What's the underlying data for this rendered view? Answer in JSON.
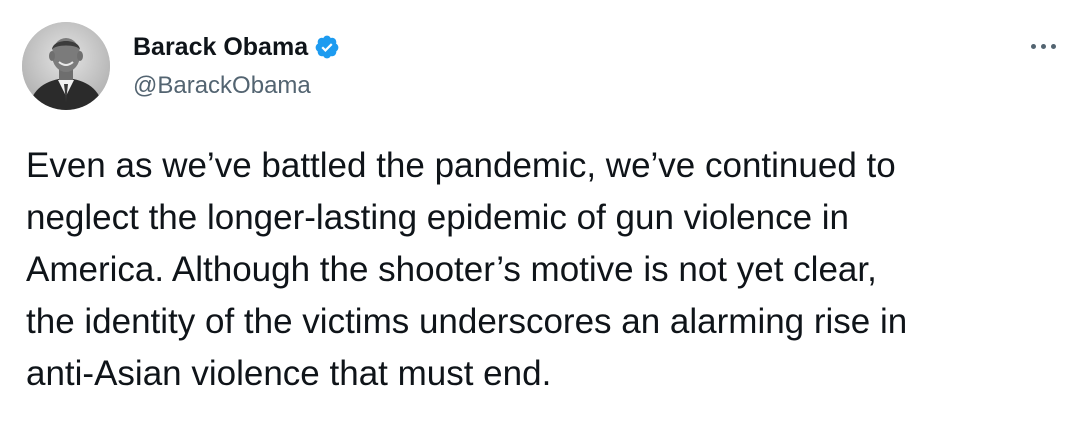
{
  "author": {
    "display_name": "Barack Obama",
    "handle": "@BarackObama",
    "verified": true,
    "avatar_icon": "profile-photo-avatar"
  },
  "tweet": {
    "text": "Even as we’ve battled the pandemic, we’ve continued to\nneglect the longer-lasting epidemic of gun violence in\nAmerica. Although the shooter’s motive is not yet clear,\nthe identity of the victims underscores an alarming rise in\nanti-Asian violence that must end."
  },
  "icons": {
    "verified": "verified-badge-icon",
    "more": "more-options-icon"
  },
  "colors": {
    "text": "#0f1419",
    "secondary": "#536471",
    "verified": "#1d9bf0",
    "background": "#ffffff"
  }
}
